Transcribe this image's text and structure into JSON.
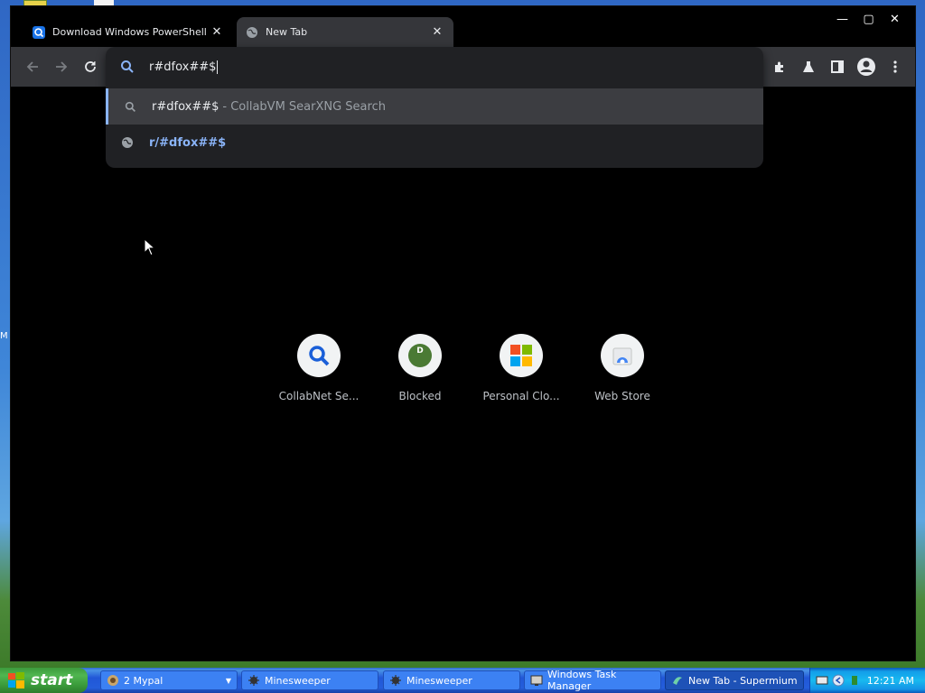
{
  "desktop": {
    "edge_label": "M"
  },
  "browser": {
    "tabs": [
      {
        "title": "Download Windows PowerShell by M",
        "active": false
      },
      {
        "title": "New Tab",
        "active": true
      }
    ],
    "window_controls": {
      "minimize": "—",
      "maximize": "▢",
      "close": "✕"
    },
    "omnibox": {
      "value": "r#dfox##$",
      "suggestions": [
        {
          "text": "r#dfox##$",
          "detail": "- CollabVM SearXNG Search",
          "icon": "search-icon"
        },
        {
          "text": "r/#dfox##$",
          "icon": "globe-icon"
        }
      ]
    },
    "shortcuts": [
      {
        "label": "CollabNet Se...",
        "icon": "search-icon"
      },
      {
        "label": "Blocked",
        "icon": "letter-d-icon",
        "letter": "D"
      },
      {
        "label": "Personal Clo...",
        "icon": "microsoft-icon"
      },
      {
        "label": "Web Store",
        "icon": "web-store-icon"
      }
    ]
  },
  "taskbar": {
    "start_label": "start",
    "tasks": [
      {
        "label": "2 Mypal",
        "icon": "mypal-icon"
      },
      {
        "label": "Minesweeper",
        "icon": "minesweeper-icon"
      },
      {
        "label": "Minesweeper",
        "icon": "minesweeper-icon"
      },
      {
        "label": "Windows Task Manager",
        "icon": "task-manager-icon"
      },
      {
        "label": "New Tab - Supermium",
        "icon": "supermium-icon",
        "active": true
      }
    ],
    "clock": "12:21 AM"
  }
}
